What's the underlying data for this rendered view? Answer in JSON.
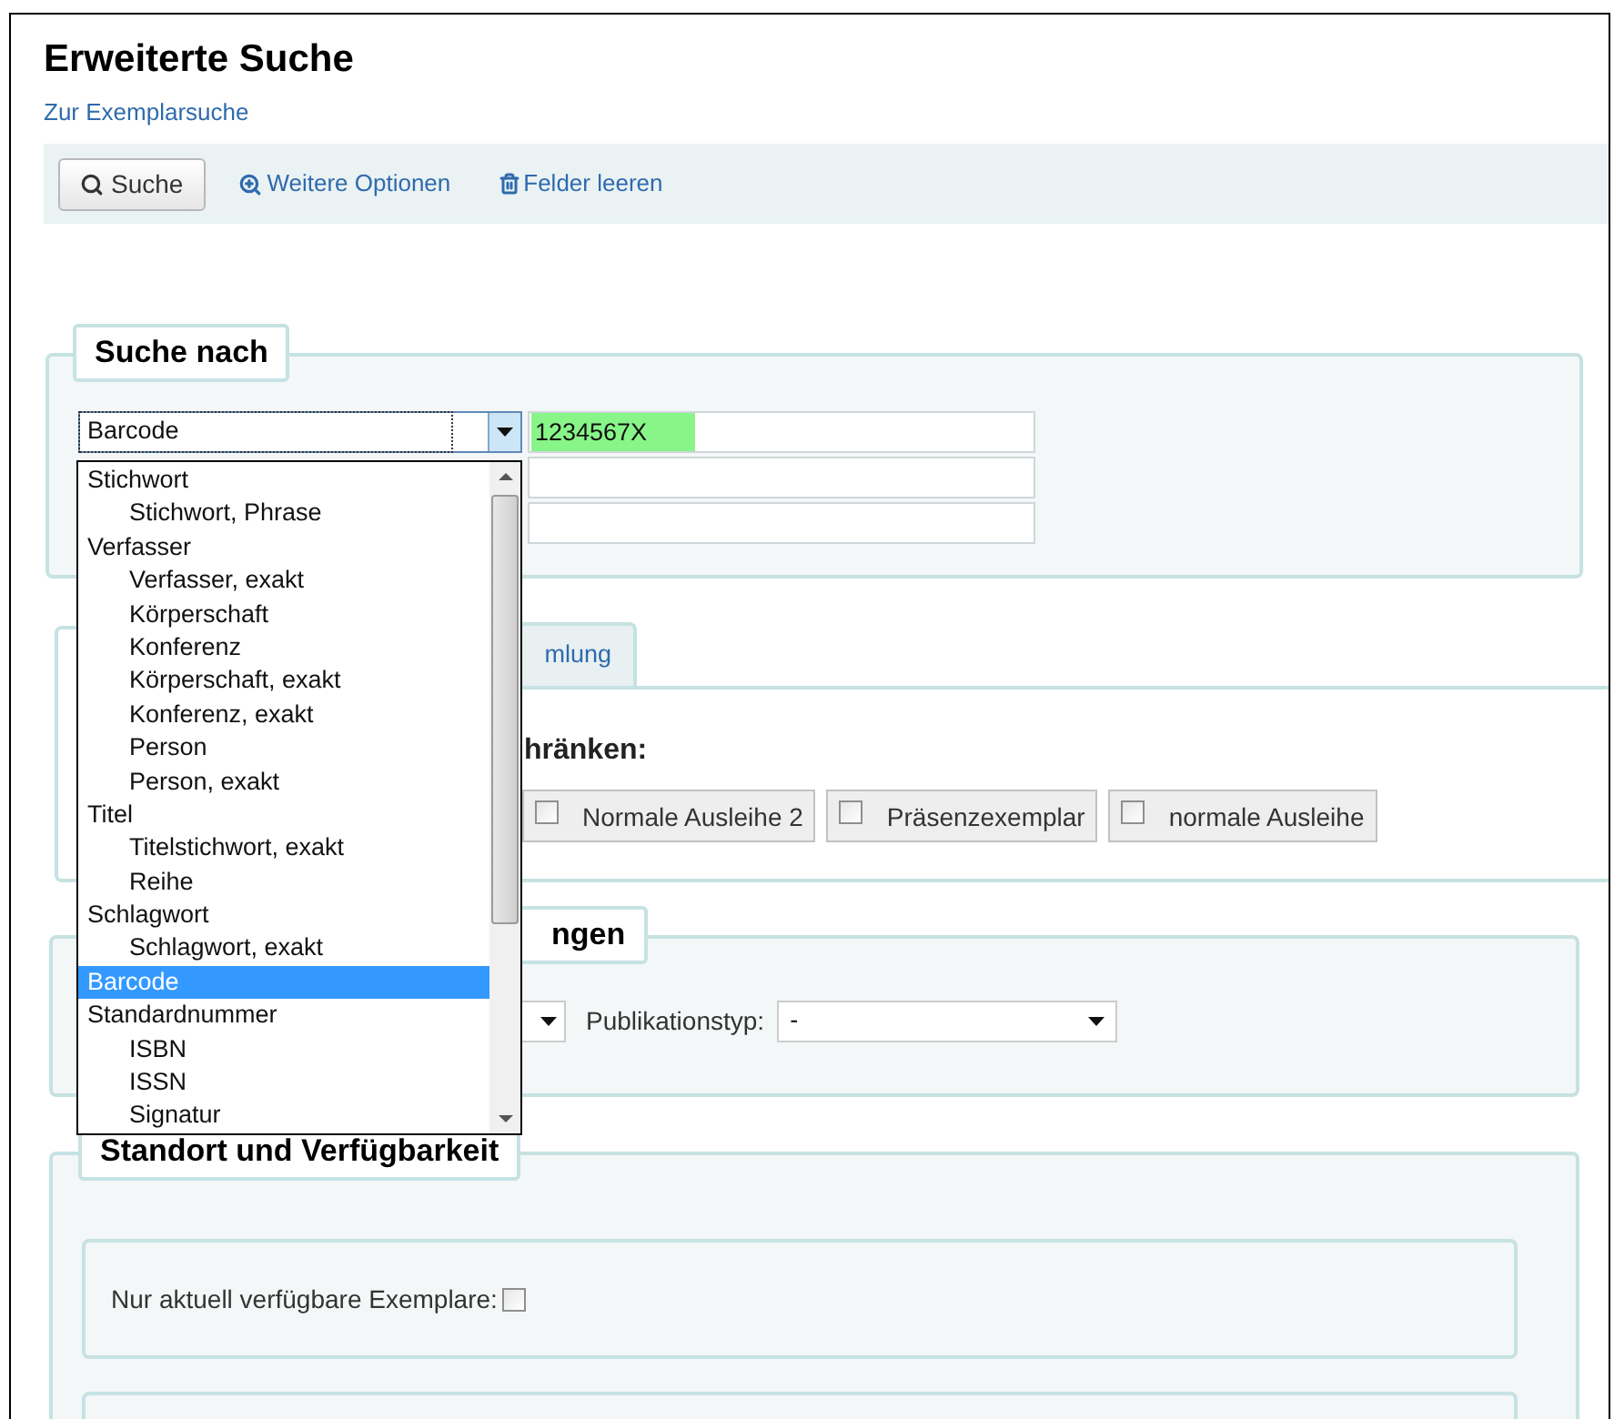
{
  "title": "Erweiterte Suche",
  "link": "Zur Exemplarsuche",
  "toolbar": {
    "search_button": "Suche",
    "more_options": "Weitere Optionen",
    "clear_fields": "Felder leeren"
  },
  "search_for": {
    "legend": "Suche nach",
    "index_select": "Barcode",
    "terms": [
      {
        "kind": "filled",
        "value": "1234567X"
      },
      {
        "kind": "empty"
      },
      {
        "kind": "empty"
      }
    ],
    "index_options": [
      {
        "label": "Stichwort",
        "selected": false,
        "children": [
          {
            "label": "Stichwort, Phrase",
            "selected": false
          }
        ]
      },
      {
        "label": "Verfasser",
        "selected": false,
        "children": [
          {
            "label": "Verfasser, exakt",
            "selected": false
          },
          {
            "label": "Körperschaft",
            "selected": false
          },
          {
            "label": "Konferenz",
            "selected": false
          },
          {
            "label": "Körperschaft, exakt",
            "selected": false
          },
          {
            "label": "Konferenz, exakt",
            "selected": false
          },
          {
            "label": "Person",
            "selected": false
          },
          {
            "label": "Person, exakt",
            "selected": false
          }
        ]
      },
      {
        "label": "Titel",
        "selected": false,
        "children": [
          {
            "label": "Titelstichwort, exakt",
            "selected": false
          },
          {
            "label": "Reihe",
            "selected": false
          }
        ]
      },
      {
        "label": "Schlagwort",
        "selected": false,
        "children": [
          {
            "label": "Schlagwort, exakt",
            "selected": false
          }
        ]
      },
      {
        "label": "Barcode",
        "selected": true
      },
      {
        "label": "Standardnummer",
        "selected": false,
        "children": [
          {
            "label": "ISBN",
            "selected": false
          },
          {
            "label": "ISSN",
            "selected": false
          },
          {
            "label": "Signatur",
            "selected": false
          }
        ]
      }
    ]
  },
  "tabs": [
    {
      "selected": true
    },
    {
      "label": "mlung",
      "selected": false
    }
  ],
  "tab_panel": {
    "heading": "hränken:",
    "item_types": [
      {
        "label": "Normale Ausleihe 2",
        "checked": false
      },
      {
        "label": "Präsenzexemplar",
        "checked": false
      },
      {
        "label": "normale Ausleihe",
        "checked": false
      }
    ]
  },
  "restrictions": {
    "legend": "ngen",
    "publication_type_label": "Publikationstyp:",
    "publication_type_value": "-"
  },
  "location": {
    "legend": "Standort und Verfügbarkeit",
    "available_only_label": "Nur aktuell verfügbare Exemplare:",
    "available_only": false
  }
}
